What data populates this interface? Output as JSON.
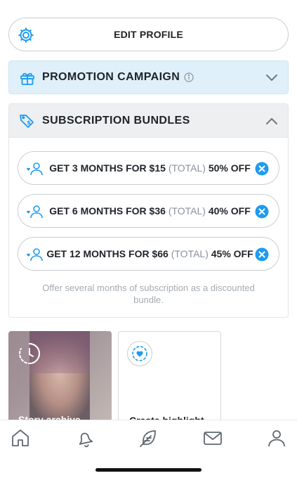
{
  "edit_profile": {
    "label": "EDIT PROFILE"
  },
  "promotion": {
    "title": "PROMOTION CAMPAIGN"
  },
  "subscription_bundles": {
    "title": "SUBSCRIPTION BUNDLES",
    "items": [
      {
        "main": "GET 3 MONTHS FOR $15",
        "total": "(TOTAL)",
        "discount": "50% OFF"
      },
      {
        "main": "GET 6 MONTHS FOR $36",
        "total": "(TOTAL)",
        "discount": "40% OFF"
      },
      {
        "main": "GET 12 MONTHS FOR $66",
        "total": "(TOTAL)",
        "discount": "45% OFF"
      }
    ],
    "note": "Offer several months of subscription as a discounted bundle."
  },
  "cards": {
    "story_archive": "Story archive",
    "create_highlight": "Create highlight"
  },
  "colors": {
    "accent": "#1d9bf0",
    "promo_bg": "#dff0fa",
    "muted_text": "#a4abb1"
  },
  "icons": {
    "edit_profile": "gear-icon",
    "promotion": "gift-icon",
    "promotion_info": "info-icon",
    "subscription": "tag-dollar-icon",
    "bundle_item": "user-heart-icon",
    "bundle_remove": "close-circle-icon",
    "story_archive": "clock-icon",
    "create_highlight": "heart-circle-icon",
    "tabs": [
      "home-icon",
      "bell-icon",
      "feather-icon",
      "envelope-icon",
      "user-icon"
    ]
  }
}
